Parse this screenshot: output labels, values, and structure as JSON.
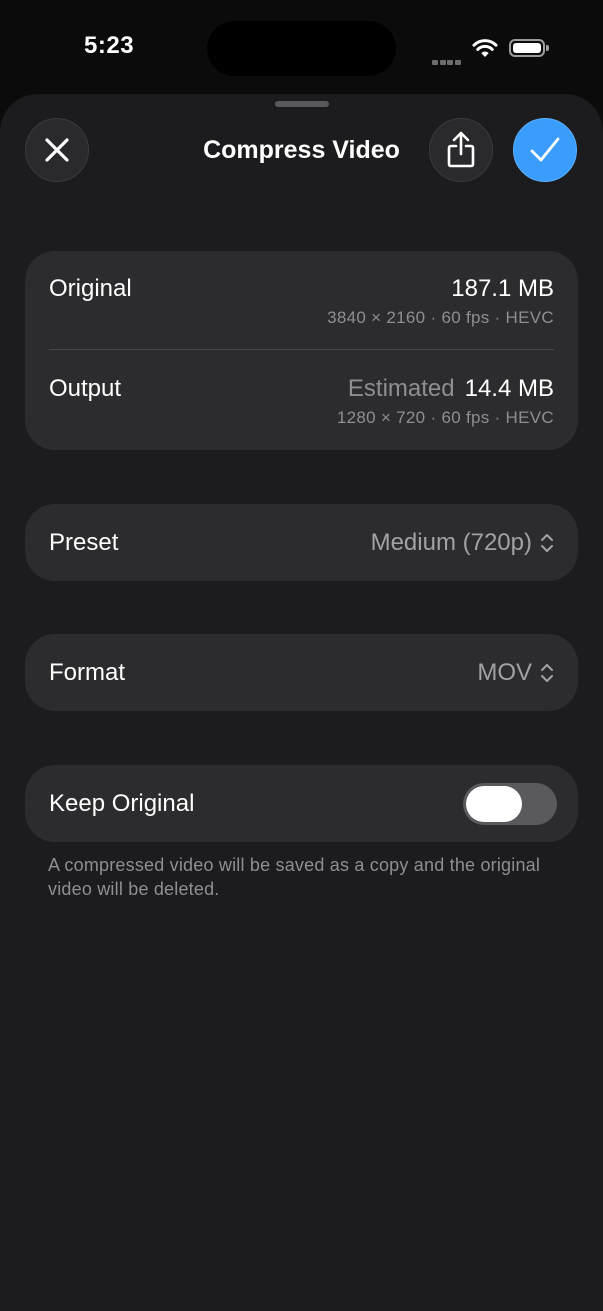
{
  "status_bar": {
    "time": "5:23"
  },
  "header": {
    "title": "Compress Video",
    "close_icon": "close-icon",
    "share_icon": "share-icon",
    "confirm_icon": "checkmark-icon"
  },
  "summary": {
    "original": {
      "label": "Original",
      "size": "187.1 MB",
      "details": "3840 × 2160 · 60 fps · HEVC"
    },
    "output": {
      "label": "Output",
      "estimated_label": "Estimated",
      "size": "14.4 MB",
      "details": "1280 × 720 · 60 fps · HEVC"
    }
  },
  "preset": {
    "label": "Preset",
    "value": "Medium (720p)"
  },
  "format": {
    "label": "Format",
    "value": "MOV"
  },
  "keep_original": {
    "label": "Keep Original",
    "enabled": false
  },
  "footnote": "A compressed video will be saved as a copy and the original video will be deleted.",
  "colors": {
    "accent": "#3a9dfb",
    "background": "#1c1c1e",
    "card": "#2c2c2e",
    "secondary_text": "#8e8e93"
  }
}
